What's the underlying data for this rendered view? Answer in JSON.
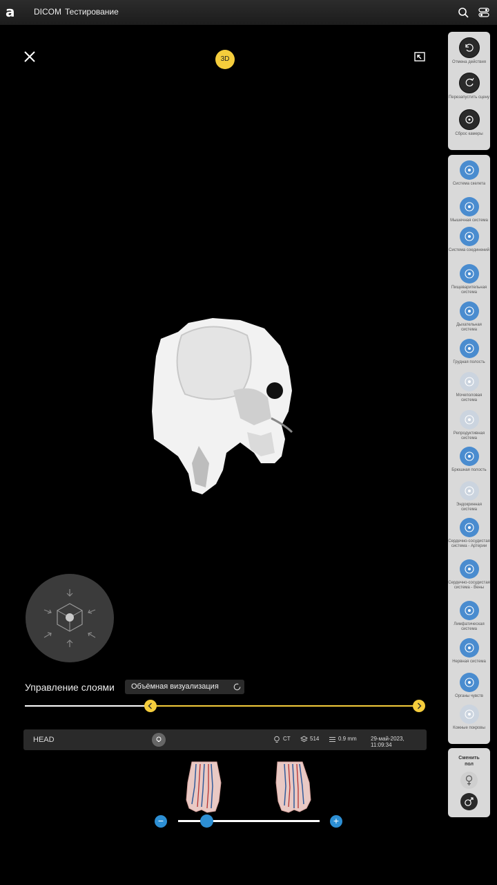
{
  "topbar": {
    "logo": "a",
    "menu": [
      "DICOM",
      "Тестирование"
    ]
  },
  "viewer": {
    "mode_badge": "3D"
  },
  "actions_panel": {
    "items": [
      {
        "label": "Отмена действия",
        "icon": "undo-icon"
      },
      {
        "label": "Перезапустить сцену",
        "icon": "restart-icon"
      },
      {
        "label": "Сброс камеры",
        "icon": "reset-camera-icon"
      }
    ]
  },
  "systems_panel": {
    "items": [
      {
        "label": "Система скелета",
        "icon": "skull-icon"
      },
      {
        "label": "Мышечная система",
        "icon": "muscle-icon"
      },
      {
        "label": "Система соединений",
        "icon": "joints-icon"
      },
      {
        "label": "Пищеварительная система",
        "icon": "stomach-icon"
      },
      {
        "label": "Дыхательная система",
        "icon": "lungs-icon"
      },
      {
        "label": "Грудная полость",
        "icon": "chest-icon"
      },
      {
        "label": "Мочеполовая система",
        "icon": "kidneys-icon"
      },
      {
        "label": "Репродуктивная система",
        "icon": "reproductive-icon"
      },
      {
        "label": "Брюшная полость",
        "icon": "abdomen-icon"
      },
      {
        "label": "Эндокринная система",
        "icon": "endocrine-icon"
      },
      {
        "label": "Сердечно-сосудистая система - Артерии",
        "icon": "heart-arteries-icon"
      },
      {
        "label": "Сердечно-сосудистая система - Вены",
        "icon": "heart-veins-icon"
      },
      {
        "label": "Лимфатическая система",
        "icon": "lymph-icon"
      },
      {
        "label": "Нервная система",
        "icon": "nerve-icon"
      },
      {
        "label": "Органы чувств",
        "icon": "eye-icon"
      },
      {
        "label": "Кожные покровы",
        "icon": "skin-icon"
      }
    ]
  },
  "gender_panel": {
    "title": "Сменить пол",
    "female_icon": "female-icon",
    "male_icon": "male-icon"
  },
  "layers": {
    "title": "Управление слоями",
    "mode": "Объёмная визуализация"
  },
  "infobar": {
    "name": "HEAD",
    "modality": "CT",
    "slices": "514",
    "thickness": "0.9 mm",
    "datetime": "29-май-2023, 11:09:34"
  },
  "size_slider": {
    "minus": "−",
    "plus": "+",
    "value_fraction": 0.2
  },
  "colors": {
    "accent_yellow": "#f5cd3c",
    "accent_blue": "#2d8fd4",
    "panel_bg": "#d9d9d9"
  }
}
